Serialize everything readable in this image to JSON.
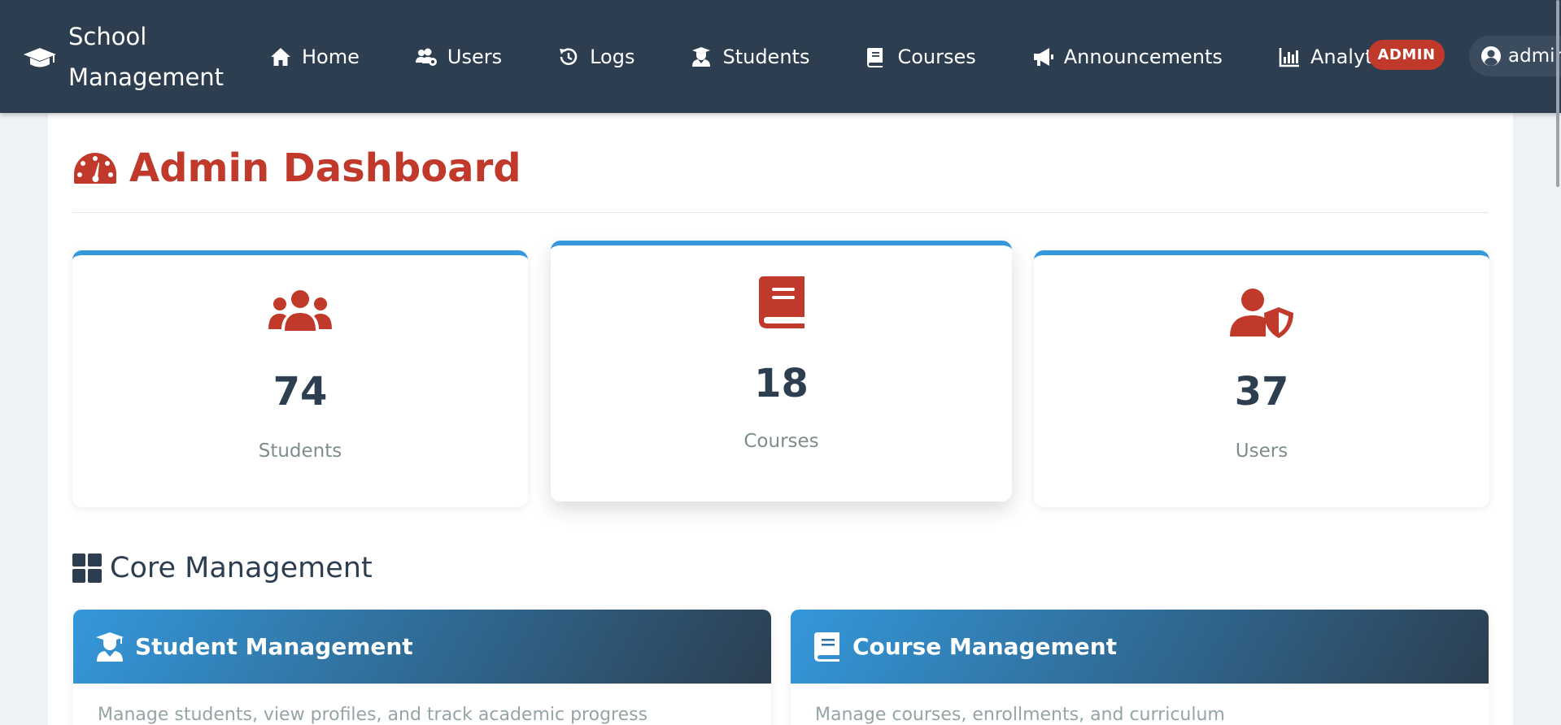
{
  "brand": {
    "line1": "School",
    "line2": "Management"
  },
  "nav": [
    {
      "label": "Home",
      "icon": "home-icon"
    },
    {
      "label": "Users",
      "icon": "users-cog-icon"
    },
    {
      "label": "Logs",
      "icon": "history-icon"
    },
    {
      "label": "Students",
      "icon": "graduate-icon"
    },
    {
      "label": "Courses",
      "icon": "book-icon"
    },
    {
      "label": "Announcements",
      "icon": "megaphone-icon"
    },
    {
      "label": "Analytics",
      "icon": "bar-chart-icon"
    }
  ],
  "badge": "ADMIN",
  "user": {
    "name": "admin"
  },
  "page": {
    "title": "Admin Dashboard"
  },
  "stats": [
    {
      "value": "74",
      "label": "Students",
      "icon": "users-icon"
    },
    {
      "value": "18",
      "label": "Courses",
      "icon": "book-icon"
    },
    {
      "value": "37",
      "label": "Users",
      "icon": "user-shield-icon"
    }
  ],
  "section": {
    "title": "Core Management"
  },
  "cards": [
    {
      "title": "Student Management",
      "desc": "Manage students, view profiles, and track academic progress"
    },
    {
      "title": "Course Management",
      "desc": "Manage courses, enrollments, and curriculum"
    }
  ],
  "colors": {
    "navbar": "#2d3e50",
    "accent": "#c0392b",
    "blue": "#3498db",
    "text": "#2c3e50"
  }
}
